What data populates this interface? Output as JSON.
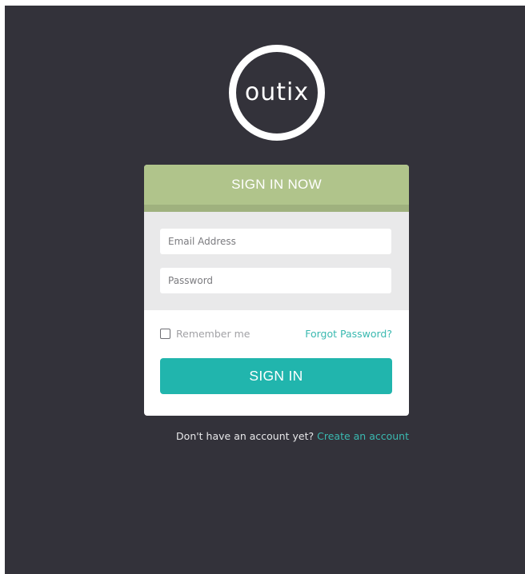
{
  "logo": {
    "text": "outix"
  },
  "card": {
    "title": "SIGN IN NOW",
    "email_placeholder": "Email Address",
    "password_placeholder": "Password",
    "remember_label": "Remember me",
    "remember_checked": false,
    "forgot_label": "Forgot Password?",
    "signin_label": "SIGN IN"
  },
  "footer": {
    "prompt": "Don't have an account yet?",
    "create_label": "Create an account"
  },
  "colors": {
    "background": "#33323a",
    "header": "#b0c48b",
    "accent": "#21b5ad",
    "link": "#3ab9b0"
  }
}
